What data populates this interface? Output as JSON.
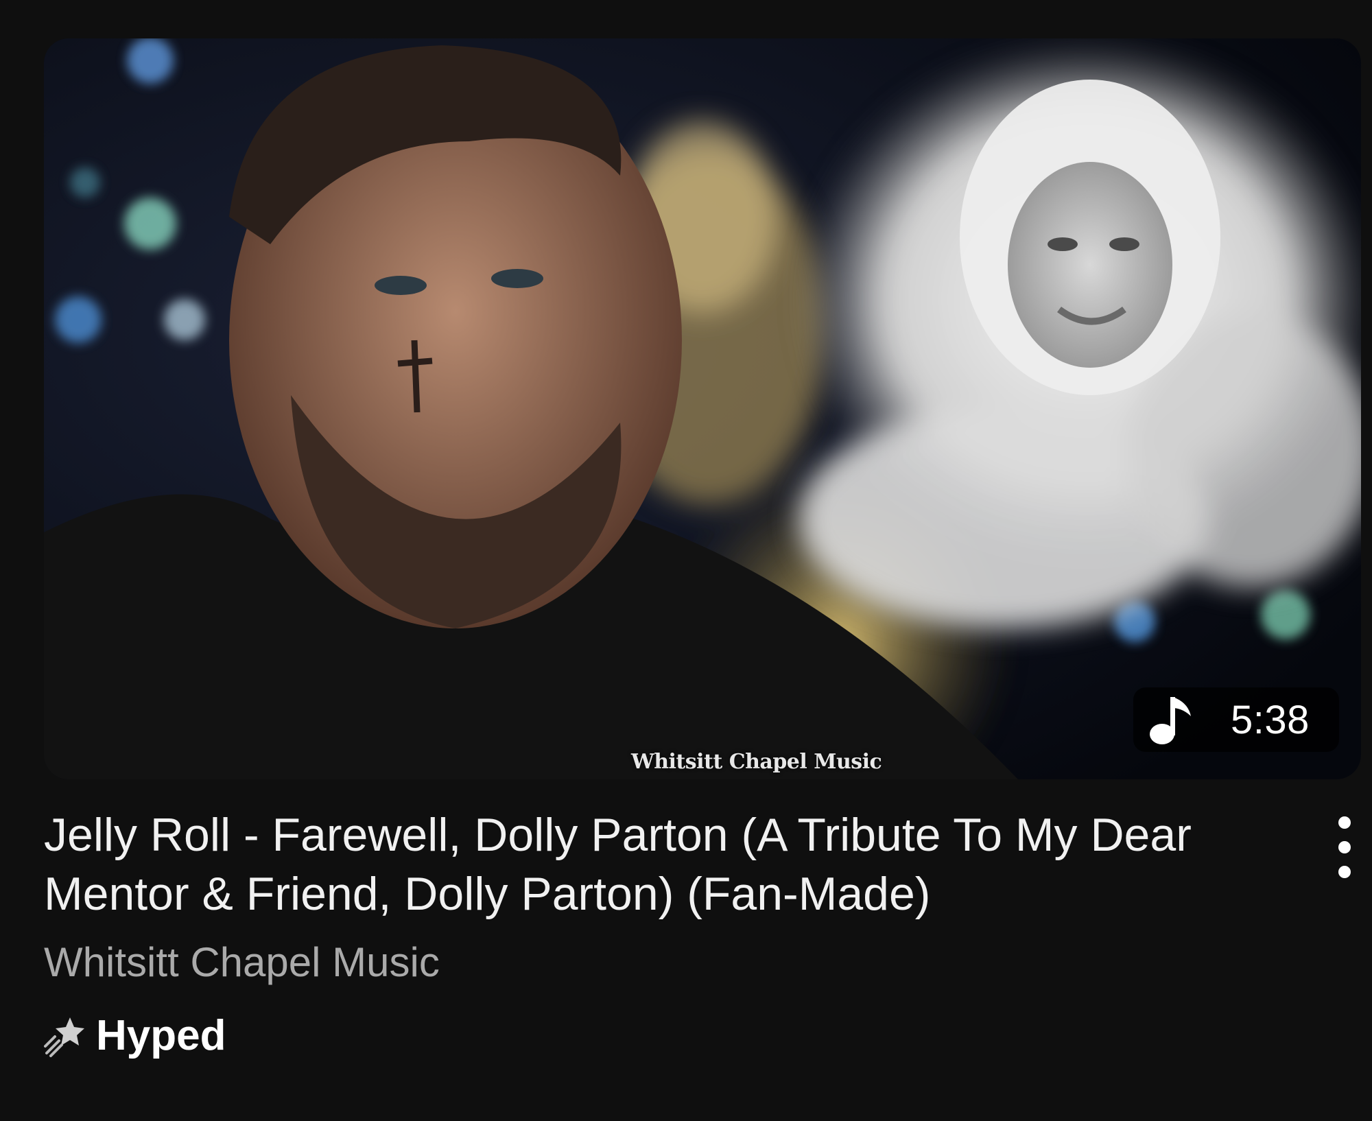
{
  "video": {
    "title": "Jelly Roll - Farewell, Dolly Parton (A Tribute To My Dear Mentor & Friend, Dolly Parton) (Fan-Made)",
    "channel": "Whitsitt Chapel Music",
    "duration": "5:38",
    "badge": "Hyped",
    "thumbnail_watermark": "Whitsitt Chapel Music",
    "duration_icon": "music-note-icon",
    "badge_icon": "shooting-star-icon",
    "menu_icon": "more-vert-icon"
  },
  "colors": {
    "background": "#0f0f0f",
    "title": "#f1f1f1",
    "channel": "#aaaaaa"
  }
}
